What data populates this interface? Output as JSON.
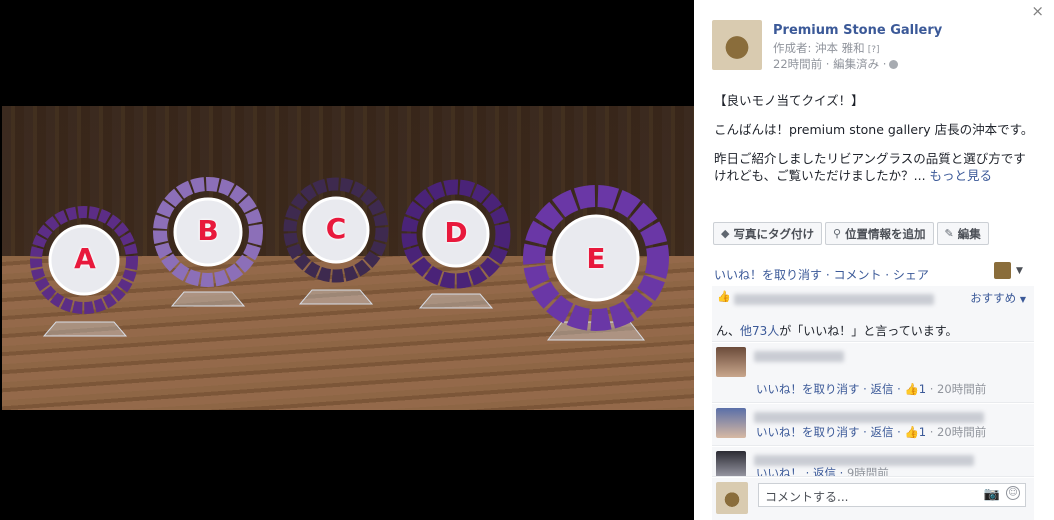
{
  "photo": {
    "alt_letters": [
      "A",
      "B",
      "C",
      "D",
      "E"
    ]
  },
  "panel": {
    "close_icon": "×",
    "page_name": "Premium Stone Gallery",
    "author": "作成者: 沖本 雅和",
    "help_mark": "[?]",
    "time": "22時間前 · 編集済み ·",
    "post": {
      "line1": "【良いモノ当てクイズ！】",
      "line2": "こんばんは！premium stone gallery 店長の沖本です。",
      "line3": "昨日ご紹介しましたリビアングラスの品質と選び方ですけれども、ご覧いただけましたか？...",
      "more": "もっと見る"
    },
    "actions": {
      "tag": "写真にタグ付け",
      "location": "位置情報を追加",
      "edit": "編集"
    },
    "interact": "いいね！を取り消す · コメント · シェア",
    "sort": "おすすめ",
    "likes_text_prefix": "ん、",
    "likes_link": "他73人",
    "likes_text_suffix": "が「いいね！」と言っています。",
    "comments": [
      {
        "actions": "いいね！を取り消す · 返信 ·",
        "likes": "1",
        "time": "· 20時間前"
      },
      {
        "actions": "いいね！を取り消す · 返信 ·",
        "likes": "1",
        "time": "· 20時間前"
      },
      {
        "actions": "いいね！ · 返信 ·",
        "likes": "",
        "time": "9時間前"
      }
    ],
    "composer_placeholder": "コメントする..."
  }
}
